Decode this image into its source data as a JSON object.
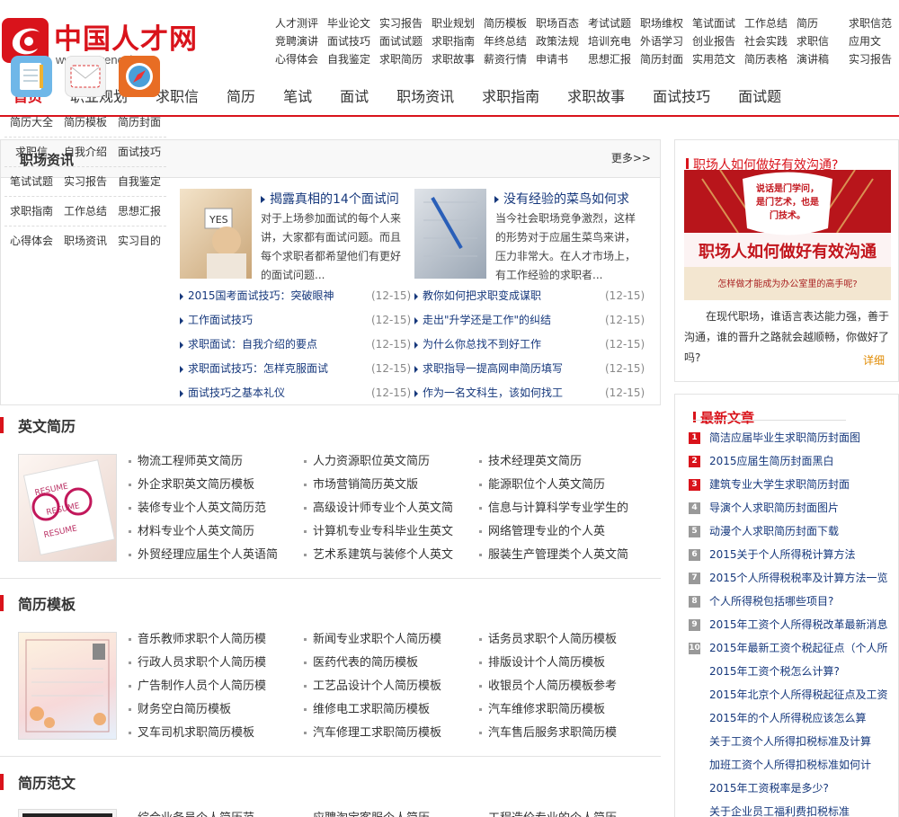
{
  "logo": {
    "name_cn": "中国人才网",
    "url": "www.CNrencai.com"
  },
  "top_links": [
    [
      "人才测评",
      "毕业论文",
      "实习报告",
      "职业规划",
      "简历模板",
      "职场百态",
      "考试试题",
      "职场维权",
      "笔试面试",
      "工作总结",
      "简历",
      "求职信范"
    ],
    [
      "竞聘演讲",
      "面试技巧",
      "面试试题",
      "求职指南",
      "年终总结",
      "政策法规",
      "培训充电",
      "外语学习",
      "创业报告",
      "社会实践",
      "求职信",
      "应用文"
    ],
    [
      "心得体会",
      "自我鉴定",
      "求职简历",
      "求职故事",
      "薪资行情",
      "申请书",
      "思想汇报",
      "简历封面",
      "实用范文",
      "简历表格",
      "演讲稿",
      "实习报告"
    ]
  ],
  "nav": [
    "首页",
    "职业规划",
    "求职信",
    "简历",
    "笔试",
    "面试",
    "职场资讯",
    "求职指南",
    "求职故事",
    "面试技巧",
    "面试题"
  ],
  "news": {
    "title": "职场资讯",
    "more": "更多>>",
    "categories": [
      "简历大全",
      "简历模板",
      "简历封面",
      "求职信",
      "自我介绍",
      "面试技巧",
      "笔试试题",
      "实习报告",
      "自我鉴定",
      "求职指南",
      "工作总结",
      "思想汇报",
      "心得体会",
      "职场资讯",
      "实习目的"
    ],
    "featured": [
      {
        "title": "揭露真相的14个面试问",
        "desc": "对于上场参加面试的每个人来讲，大家都有面试问题。而且每个求职者都希望他们有更好的面试问题..."
      },
      {
        "title": "没有经验的菜鸟如何求",
        "desc": "当今社会职场竞争激烈，这样的形势对于应届生菜鸟来讲，压力非常大。在人才市场上，有工作经验的求职者..."
      }
    ],
    "left_list": [
      {
        "t": "2015国考面试技巧：突破眼神",
        "d": "(12-15)"
      },
      {
        "t": "工作面试技巧",
        "d": "(12-15)"
      },
      {
        "t": "求职面试：自我介绍的要点",
        "d": "(12-15)"
      },
      {
        "t": "求职面试技巧：怎样克服面试",
        "d": "(12-15)"
      },
      {
        "t": "面试技巧之基本礼仪",
        "d": "(12-15)"
      }
    ],
    "right_list": [
      {
        "t": "教你如何把求职变成谋职",
        "d": "(12-15)"
      },
      {
        "t": "走出\"升学还是工作\"的纠结",
        "d": "(12-15)"
      },
      {
        "t": "为什么你总找不到好工作",
        "d": "(12-15)"
      },
      {
        "t": "求职指导一提高网申简历填写",
        "d": "(12-15)"
      },
      {
        "t": "作为一名文科生，该如何找工",
        "d": "(12-15)"
      }
    ]
  },
  "sections": [
    {
      "title": "英文简历",
      "items": [
        "物流工程师英文简历",
        "人力资源职位英文简历",
        "技术经理英文简历",
        "外企求职英文简历模板",
        "市场营销简历英文版",
        "能源职位个人英文简历",
        "装修专业个人英文简历范",
        "高级设计师专业个人英文简",
        "信息与计算科学专业学生的",
        "材料专业个人英文简历",
        "计算机专业专科毕业生英文",
        "网络管理专业的个人英",
        "外贸经理应届生个人英语简",
        "艺术系建筑与装修个人英文",
        "服装生产管理类个人英文简"
      ]
    },
    {
      "title": "简历模板",
      "items": [
        "音乐教师求职个人简历模",
        "新闻专业求职个人简历模",
        "话务员求职个人简历模板",
        "行政人员求职个人简历模",
        "医药代表的简历模板",
        "排版设计个人简历模板",
        "广告制作人员个人简历模",
        "工艺品设计个人简历模板",
        "收银员个人简历模板参考",
        "财务空白简历模板",
        "维修电工求职简历模板",
        "汽车维修求职简历模板",
        "叉车司机求职简历模板",
        "汽车修理工求职简历模板",
        "汽车售后服务求职简历模"
      ]
    },
    {
      "title": "简历范文",
      "items": [
        "综合业务员个人简历范",
        "应聘淘宝客服个人简历",
        "工程造价专业的个人简历"
      ]
    }
  ],
  "ad": {
    "title": "职场人如何做好有效沟通?",
    "banner_small": "说话是门学问，是门艺术，也是门技术。",
    "banner_big": "职场人如何做好有效沟通",
    "banner_foot": "怎样做才能成为办公室里的高手呢?",
    "text": "在现代职场，谁语言表达能力强，善于沟通，谁的晋升之路就会越顺畅，你做好了吗?",
    "more": "详细"
  },
  "latest": {
    "title": "最新文章",
    "items": [
      "简洁应届毕业生求职简历封面图",
      "2015应届生简历封面黑白",
      "建筑专业大学生求职简历封面",
      "导演个人求职简历封面图片",
      "动漫个人求职简历封面下载",
      "2015关于个人所得税计算方法",
      "2015个人所得税税率及计算方法一览",
      "个人所得税包括哪些项目?",
      "2015年工资个人所得税改革最新消息",
      "2015年最新工资个税起征点（个人所",
      "2015年工资个税怎么计算?",
      "2015年北京个人所得税起征点及工资",
      "2015年的个人所得税应该怎么算",
      "关于工资个人所得扣税标准及计算",
      "加班工资个人所得扣税标准如何计",
      "2015年工资税率是多少?",
      "关于企业员工福利费扣税标准"
    ]
  }
}
